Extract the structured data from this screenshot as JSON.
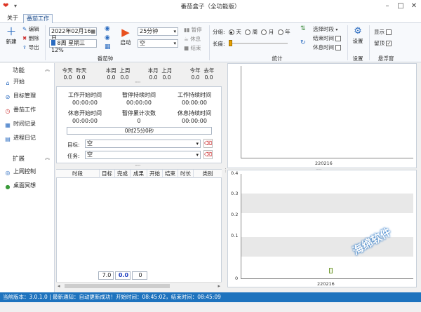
{
  "window": {
    "title": "番茄盒子（全功能版）"
  },
  "menu": {
    "items": [
      "关于",
      "番茄工作"
    ]
  },
  "ribbon": {
    "new_label": "新建",
    "edit_label": "编辑",
    "delete_label": "删除",
    "export_label": "导出",
    "date_value": "2022年02月16日",
    "week_label": "8周 星期三 12%",
    "timer_group_label": "番茄钟",
    "start_label": "启动",
    "duration_value": "25分钟",
    "type_value": "空",
    "pause_label": "暂停",
    "rest_label": "休息",
    "end_label": "结束",
    "group_by_label": "分组:",
    "group_options": [
      "天",
      "周",
      "月",
      "年"
    ],
    "group_selected": "天",
    "length_label": "长度:",
    "select_period_label": "选择时段",
    "end_time_label": "结束时间",
    "rest_time_label": "休息时间",
    "stats_group_label": "统计",
    "settings_label": "设置",
    "settings_group_label": "设置",
    "show_label": "显示",
    "topmost_label": "留顶",
    "float_group_label": "悬浮窗"
  },
  "sidebar": {
    "section1": "功能",
    "items": [
      {
        "label": "开始",
        "icon": "home-icon"
      },
      {
        "label": "目标管理",
        "icon": "target-icon"
      },
      {
        "label": "番茄工作",
        "icon": "clock-icon"
      },
      {
        "label": "时间记录",
        "icon": "calendar-icon"
      },
      {
        "label": "进程日记",
        "icon": "diary-icon"
      }
    ],
    "section2": "扩展",
    "items2": [
      {
        "label": "上网控制",
        "icon": "network-icon"
      },
      {
        "label": "桌面冥想",
        "icon": "meditation-icon"
      }
    ]
  },
  "stats": [
    {
      "h1": "今天",
      "h2": "昨天",
      "v1": "0.0",
      "v2": "0.0"
    },
    {
      "h1": "本周",
      "h2": "上周",
      "v1": "0.0",
      "v2": "0.0"
    },
    {
      "h1": "本月",
      "h2": "上月",
      "v1": "0.0",
      "v2": "0.0"
    },
    {
      "h1": "今年",
      "h2": "去年",
      "v1": "0.0",
      "v2": "0.0"
    }
  ],
  "timer_info": {
    "work_start_label": "工作开始时间",
    "work_start_value": "00:00:00",
    "pause_duration_label": "暂停持续时间",
    "pause_duration_value": "00:00:00",
    "work_duration_label": "工作持续时间",
    "work_duration_value": "00:00:00",
    "rest_start_label": "休息开始时间",
    "rest_start_value": "00:00:00",
    "pause_count_label": "暂停累计次数",
    "pause_count_value": "0",
    "rest_duration_label": "休息持续时间",
    "rest_duration_value": "00:00:00",
    "progress_text": "0时25分0秒",
    "target_label": "目标:",
    "target_value": "空",
    "task_label": "任务:",
    "task_value": "空"
  },
  "table": {
    "columns": [
      "时段",
      "目标",
      "完成",
      "成果",
      "开始",
      "结束",
      "时长",
      "类别"
    ],
    "footer": [
      "7.0",
      "0.0",
      "0"
    ]
  },
  "chart_top": {
    "x_label": "220216"
  },
  "chart_bottom": {
    "y_ticks": [
      "0.4",
      "0.3",
      "0.2",
      "0.1",
      "0"
    ],
    "x_label": "220216"
  },
  "status": {
    "text": "当前版本：3.0.1.0 | 最新通知：自动更新成功！开始时间：08:45:02，结束时间：08:45:09"
  },
  "watermark": "海绵软件"
}
